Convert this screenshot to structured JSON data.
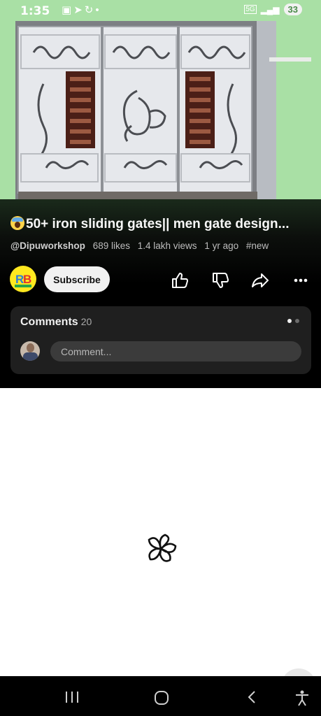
{
  "status_bar": {
    "time": "1:35",
    "left_icons": [
      "screenshot-icon",
      "telegram-icon",
      "app-icon",
      "dot-icon"
    ],
    "network_label": "5G",
    "battery_level": "33"
  },
  "video": {
    "thumbnail_desc_icon": "gate-thumbnail-icon",
    "title_emoji": "scream-emoji-icon",
    "title": "50+ iron sliding gates|| men gate design...",
    "channel": "@Dipuworkshop",
    "likes": "689 likes",
    "views": "1.4 lakh views",
    "age": "1 yr ago",
    "hashtag": "#new"
  },
  "actions": {
    "subscribe_label": "Subscribe",
    "icons": [
      "like-icon",
      "dislike-icon",
      "share-icon",
      "more-icon"
    ]
  },
  "comments": {
    "header": "Comments",
    "count": "20",
    "placeholder": "Comment..."
  },
  "colors": {
    "video_bg": "#a9e0a5",
    "panel_bg": "#000000",
    "card_bg": "#1f1f1f",
    "input_bg": "#3b3b3b"
  },
  "nav_bar": {
    "icons": [
      "recent-apps-icon",
      "home-icon",
      "back-icon",
      "accessibility-icon"
    ]
  }
}
